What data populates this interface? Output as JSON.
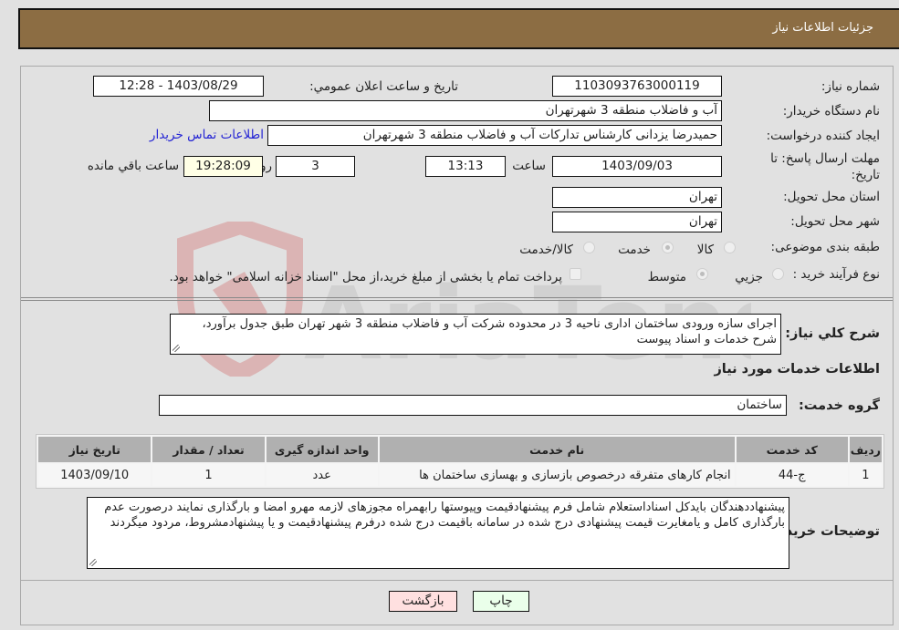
{
  "header": {
    "title": "جزئیات اطلاعات نیاز"
  },
  "form": {
    "need_number": {
      "label": "شماره نیاز:",
      "value": "1103093763000119"
    },
    "announce_datetime": {
      "label": "تاریخ و ساعت اعلان عمومي:",
      "value": "1403/08/29 - 12:28"
    },
    "buyer_org": {
      "label": "نام دستگاه خريدار:",
      "value": "آب و فاضلاب منطقه 3 شهرتهران"
    },
    "requester": {
      "label": "ایجاد کننده درخواست:",
      "value": "حمیدرضا یزدانی کارشناس تدارکات آب و فاضلاب منطقه 3 شهرتهران"
    },
    "buyer_contact_link": "اطلاعات تماس خريدار",
    "deadline": {
      "label": "مهلت ارسال پاسخ: تا تاریخ:",
      "date": "1403/09/03",
      "time_label": "ساعت",
      "time": "13:13",
      "days": "3",
      "days_label": "روز و",
      "remaining": "19:28:09",
      "remaining_label": "ساعت باقي مانده"
    },
    "province": {
      "label": "استان محل تحویل:",
      "value": "تهران"
    },
    "city": {
      "label": "شهر محل تحویل:",
      "value": "تهران"
    },
    "category": {
      "label": "طبقه بندی موضوعی:",
      "options": [
        "کالا",
        "خدمت",
        "کالا/خدمت"
      ],
      "selected": "خدمت"
    },
    "purchase_process": {
      "label": "نوع فرآیند خرید :",
      "options": [
        "جزيي",
        "متوسط"
      ],
      "selected": "متوسط",
      "treasury_checkbox_label": "پرداخت تمام یا بخشی از مبلغ خرید،از محل \"اسناد خزانه اسلامی\" خواهد بود.",
      "treasury_checked": false
    },
    "description": {
      "label": "شرح کلي نياز:",
      "value": "اجرای سازه ورودی ساختمان اداری ناحیه 3 در محدوده شرکت آب و فاضلاب منطقه 3 شهر تهران طبق جدول برآورد، شرح خدمات و اسناد پیوست"
    },
    "services_section_title": "اطلاعات خدمات مورد نياز",
    "service_group": {
      "label": "گروه خدمت:",
      "value": "ساختمان"
    }
  },
  "services_table": {
    "headers": [
      "رديف",
      "کد خدمت",
      "نام خدمت",
      "واحد اندازه گيری",
      "تعداد / مقدار",
      "تاریخ نیاز"
    ],
    "rows": [
      [
        "1",
        "ج-44",
        "انجام کارهای متفرقه درخصوص بازسازی و بهسازی ساختمان ها",
        "عدد",
        "1",
        "1403/09/10"
      ]
    ]
  },
  "buyer_notes": {
    "label": "توضيحات خريدار:",
    "value": "پیشنهاددهندگان بایدکل اسناداستعلام شامل فرم پیشنهادقیمت وپیوستها رابهمراه مجوزهای لازمه مهرو امضا و بارگذاری نمایند درصورت عدم بارگذاری کامل و یامغایرت قیمت پیشنهادی درج شده در سامانه باقیمت درج شده درفرم پیشنهادقیمت و یا پیشنهادمشروط، مردود میگردند"
  },
  "buttons": {
    "print": "چاپ",
    "back": "بازگشت"
  },
  "watermark": {
    "text": "AriaTender.net"
  },
  "colors": {
    "header_bg": "#8c6d43",
    "print_btn_bg": "#eaffea",
    "back_btn_bg": "#ffe0e0",
    "link": "#2424d4",
    "remaining_bg": "#ffffe6"
  }
}
